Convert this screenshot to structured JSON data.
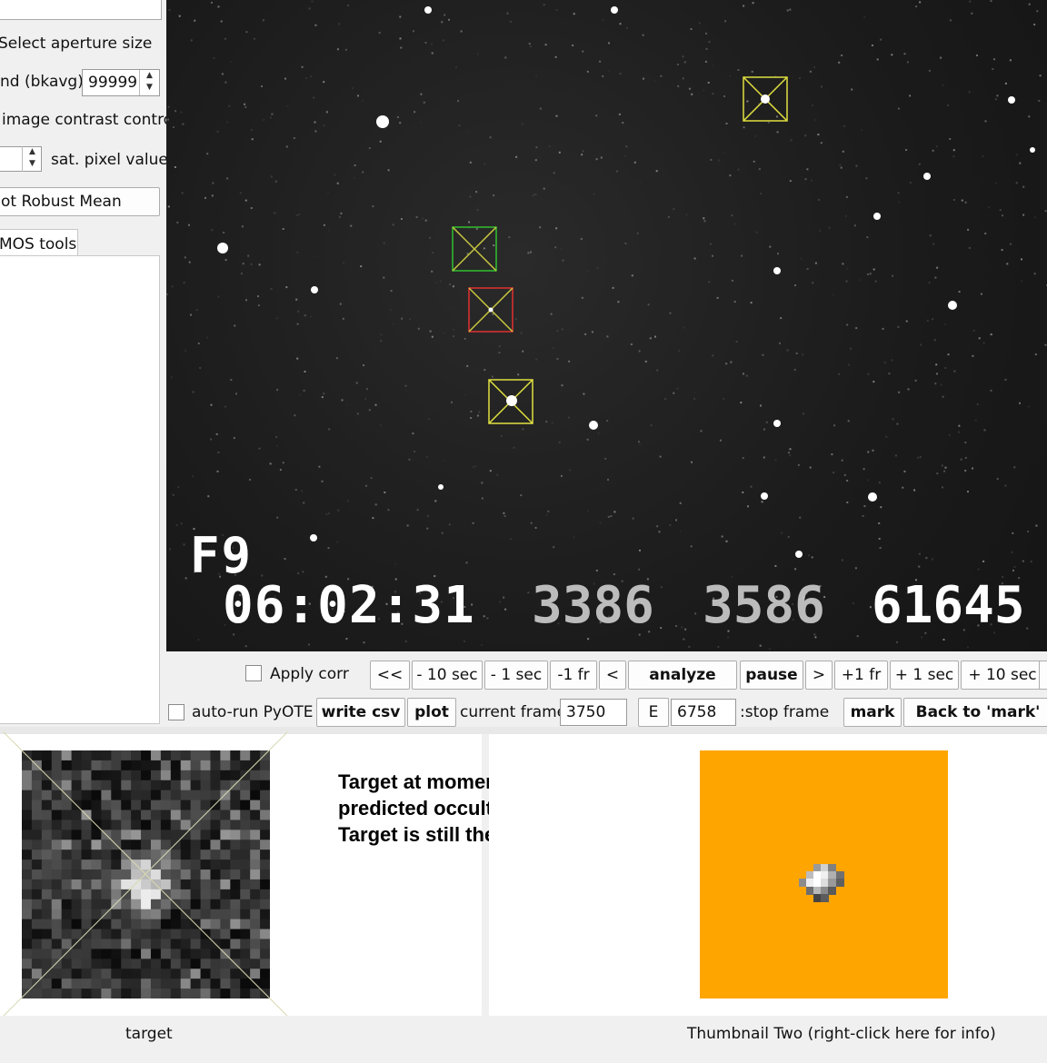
{
  "left_panel": {
    "select_aperture_label": "Select aperture size",
    "bkavg_label": "nd (bkavg)",
    "bkavg_value": "99999",
    "contrast_label": "image contrast control",
    "sat_pixel_label": "sat. pixel value",
    "robust_mean_button": "ot Robust Mean",
    "tab_label": "MOS tools"
  },
  "video": {
    "field_label": "F9",
    "timestamp": "06:02:31",
    "counter_a": "3386",
    "counter_b": "3586",
    "counter_c": "61645",
    "aperture_colors": {
      "target": "#e0e040",
      "green": "#30c030",
      "red": "#e03030"
    }
  },
  "controls": {
    "apply_corr_label": "Apply corr",
    "auto_run_label": "auto-run PyOTE",
    "nav_buttons": [
      "<<",
      "- 10 sec",
      "- 1 sec",
      "-1 fr",
      "<",
      "analyze",
      "pause",
      ">",
      "+1 fr",
      "+ 1 sec",
      "+ 10 sec"
    ],
    "write_csv": "write csv",
    "plot": "plot",
    "current_frame_label": "current frame:",
    "current_frame_value": "3750",
    "e_button": "E",
    "stop_frame_value": "6758",
    "stop_frame_label": ":stop frame",
    "mark": "mark",
    "back_to_mark": "Back to 'mark'"
  },
  "annotation": {
    "line1": "Target at moment of",
    "line2": "predicted occultation.",
    "line3": "Target is still there."
  },
  "thumbnails": {
    "one_caption": "target",
    "two_caption": "Thumbnail Two (right-click here for info)",
    "two_background": "#ffa500"
  }
}
